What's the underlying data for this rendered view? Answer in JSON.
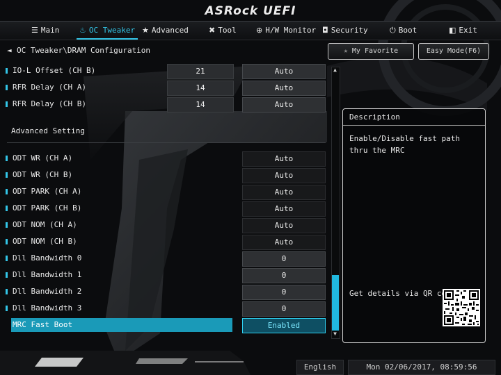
{
  "brand": {
    "logo_text": "ASRock UEFI"
  },
  "tabs": [
    {
      "label": "Main",
      "icon": "list-icon",
      "glyph": "☰"
    },
    {
      "label": "OC Tweaker",
      "icon": "flame-icon",
      "glyph": "♨",
      "active": true
    },
    {
      "label": "Advanced",
      "icon": "star-icon",
      "glyph": "★"
    },
    {
      "label": "Tool",
      "icon": "tools-icon",
      "glyph": "✖"
    },
    {
      "label": "H/W Monitor",
      "icon": "monitor-icon",
      "glyph": "⊕"
    },
    {
      "label": "Security",
      "icon": "shield-icon",
      "glyph": "◘"
    },
    {
      "label": "Boot",
      "icon": "power-icon",
      "glyph": "⏻"
    },
    {
      "label": "Exit",
      "icon": "exit-icon",
      "glyph": "◧"
    }
  ],
  "breadcrumb": {
    "path": "OC Tweaker\\DRAM Configuration",
    "back_glyph": "◄"
  },
  "buttons": {
    "favorite": "My Favorite",
    "easy_mode": "Easy Mode(F6)",
    "favorite_glyph": "★"
  },
  "rows_top": [
    {
      "label": "IO-L Offset (CH B)",
      "number": "21",
      "value": "Auto"
    },
    {
      "label": "RFR Delay (CH A)",
      "number": "14",
      "value": "Auto"
    },
    {
      "label": "RFR Delay (CH B)",
      "number": "14",
      "value": "Auto"
    }
  ],
  "section_title": "Advanced Setting",
  "rows_adv": [
    {
      "label": "ODT WR (CH A)",
      "value": "Auto"
    },
    {
      "label": "ODT WR (CH B)",
      "value": "Auto"
    },
    {
      "label": "ODT PARK (CH A)",
      "value": "Auto"
    },
    {
      "label": "ODT PARK (CH B)",
      "value": "Auto"
    },
    {
      "label": "ODT NOM (CH A)",
      "value": "Auto"
    },
    {
      "label": "ODT NOM (CH B)",
      "value": "Auto"
    },
    {
      "label": "Dll Bandwidth 0",
      "value": "0"
    },
    {
      "label": "Dll Bandwidth 1",
      "value": "0"
    },
    {
      "label": "Dll Bandwidth 2",
      "value": "0"
    },
    {
      "label": "Dll Bandwidth 3",
      "value": "0"
    },
    {
      "label": "MRC Fast Boot",
      "value": "Enabled",
      "selected": true
    }
  ],
  "description": {
    "title": "Description",
    "body": "Enable/Disable fast path thru the MRC",
    "qr_text": "Get details via QR code"
  },
  "status": {
    "language": "English",
    "datetime": "Mon 02/06/2017, 08:59:56"
  },
  "colors": {
    "accent": "#33c6e8",
    "selected_row": "#1a9ab8",
    "enabled_border": "#2fd0f0"
  }
}
